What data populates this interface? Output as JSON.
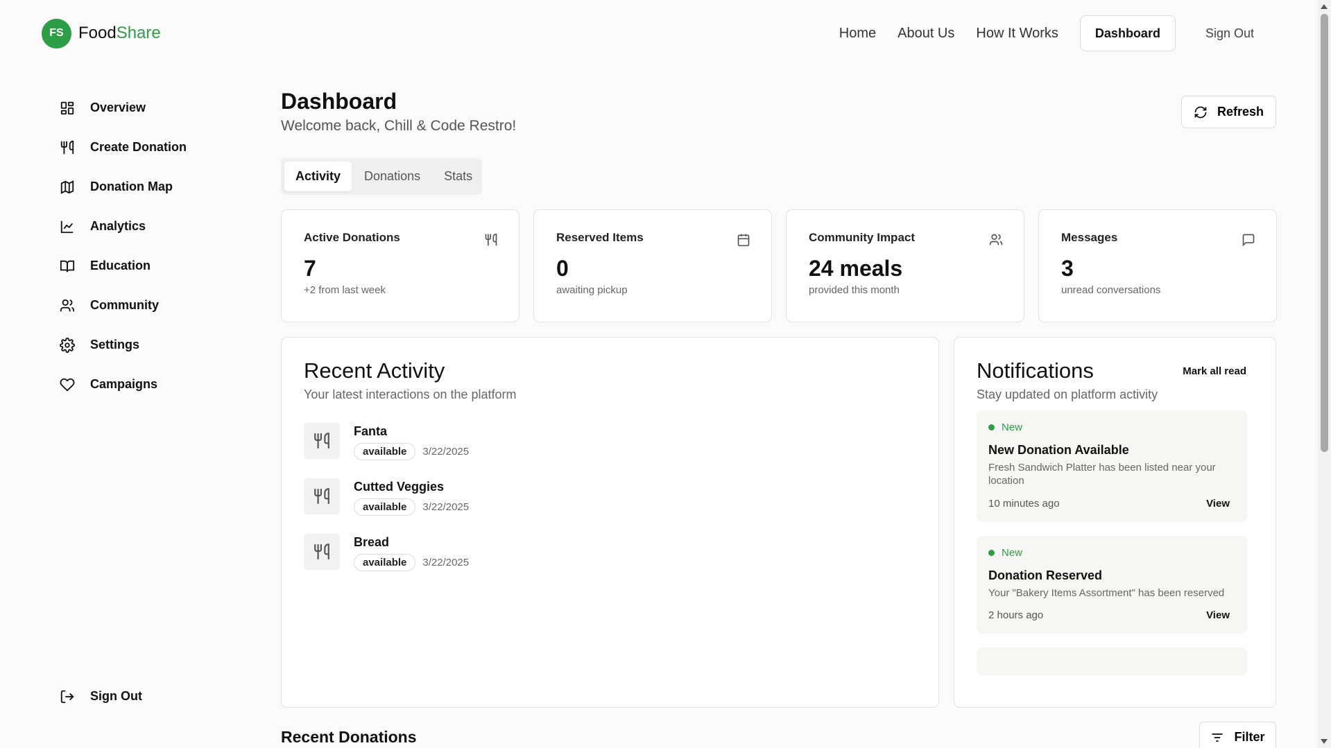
{
  "brand": {
    "badge": "FS",
    "name_prefix": "Food",
    "name_accent": "Share"
  },
  "topnav": {
    "home": "Home",
    "about": "About Us",
    "how": "How It Works",
    "dashboard": "Dashboard",
    "signout": "Sign Out"
  },
  "sidebar": {
    "items": [
      {
        "label": "Overview",
        "icon": "grid-icon"
      },
      {
        "label": "Create Donation",
        "icon": "utensils-icon"
      },
      {
        "label": "Donation Map",
        "icon": "map-icon"
      },
      {
        "label": "Analytics",
        "icon": "chart-icon"
      },
      {
        "label": "Education",
        "icon": "book-icon"
      },
      {
        "label": "Community",
        "icon": "users-icon"
      },
      {
        "label": "Settings",
        "icon": "gear-icon"
      },
      {
        "label": "Campaigns",
        "icon": "heart-icon"
      }
    ],
    "signout": "Sign Out"
  },
  "main": {
    "title": "Dashboard",
    "subtitle": "Welcome back, Chill & Code Restro!",
    "refresh": "Refresh",
    "tabs": [
      "Activity",
      "Donations",
      "Stats"
    ],
    "active_tab": "Activity",
    "stats": [
      {
        "label": "Active Donations",
        "value": "7",
        "note": "+2 from last week",
        "icon": "utensils-icon"
      },
      {
        "label": "Reserved Items",
        "value": "0",
        "note": "awaiting pickup",
        "icon": "calendar-icon"
      },
      {
        "label": "Community Impact",
        "value": "24 meals",
        "note": "provided this month",
        "icon": "users-icon"
      },
      {
        "label": "Messages",
        "value": "3",
        "note": "unread conversations",
        "icon": "message-icon"
      }
    ],
    "activity": {
      "title": "Recent Activity",
      "subtitle": "Your latest interactions on the platform",
      "items": [
        {
          "name": "Fanta",
          "status": "available",
          "date": "3/22/2025"
        },
        {
          "name": "Cutted Veggies",
          "status": "available",
          "date": "3/22/2025"
        },
        {
          "name": "Bread",
          "status": "available",
          "date": "3/22/2025"
        }
      ]
    },
    "notifications": {
      "title": "Notifications",
      "mark_all": "Mark all read",
      "subtitle": "Stay updated on platform activity",
      "items": [
        {
          "tag": "New",
          "title": "New Donation Available",
          "desc": "Fresh Sandwich Platter has been listed near your location",
          "time": "10 minutes ago",
          "action": "View"
        },
        {
          "tag": "New",
          "title": "Donation Reserved",
          "desc": "Your \"Bakery Items Assortment\" has been reserved",
          "time": "2 hours ago",
          "action": "View"
        }
      ]
    },
    "recent_donations": "Recent Donations",
    "filter": "Filter"
  },
  "colors": {
    "accent": "#2e9e46",
    "background": "#fafafa",
    "card": "#ffffff",
    "border": "#e3e3e3"
  }
}
